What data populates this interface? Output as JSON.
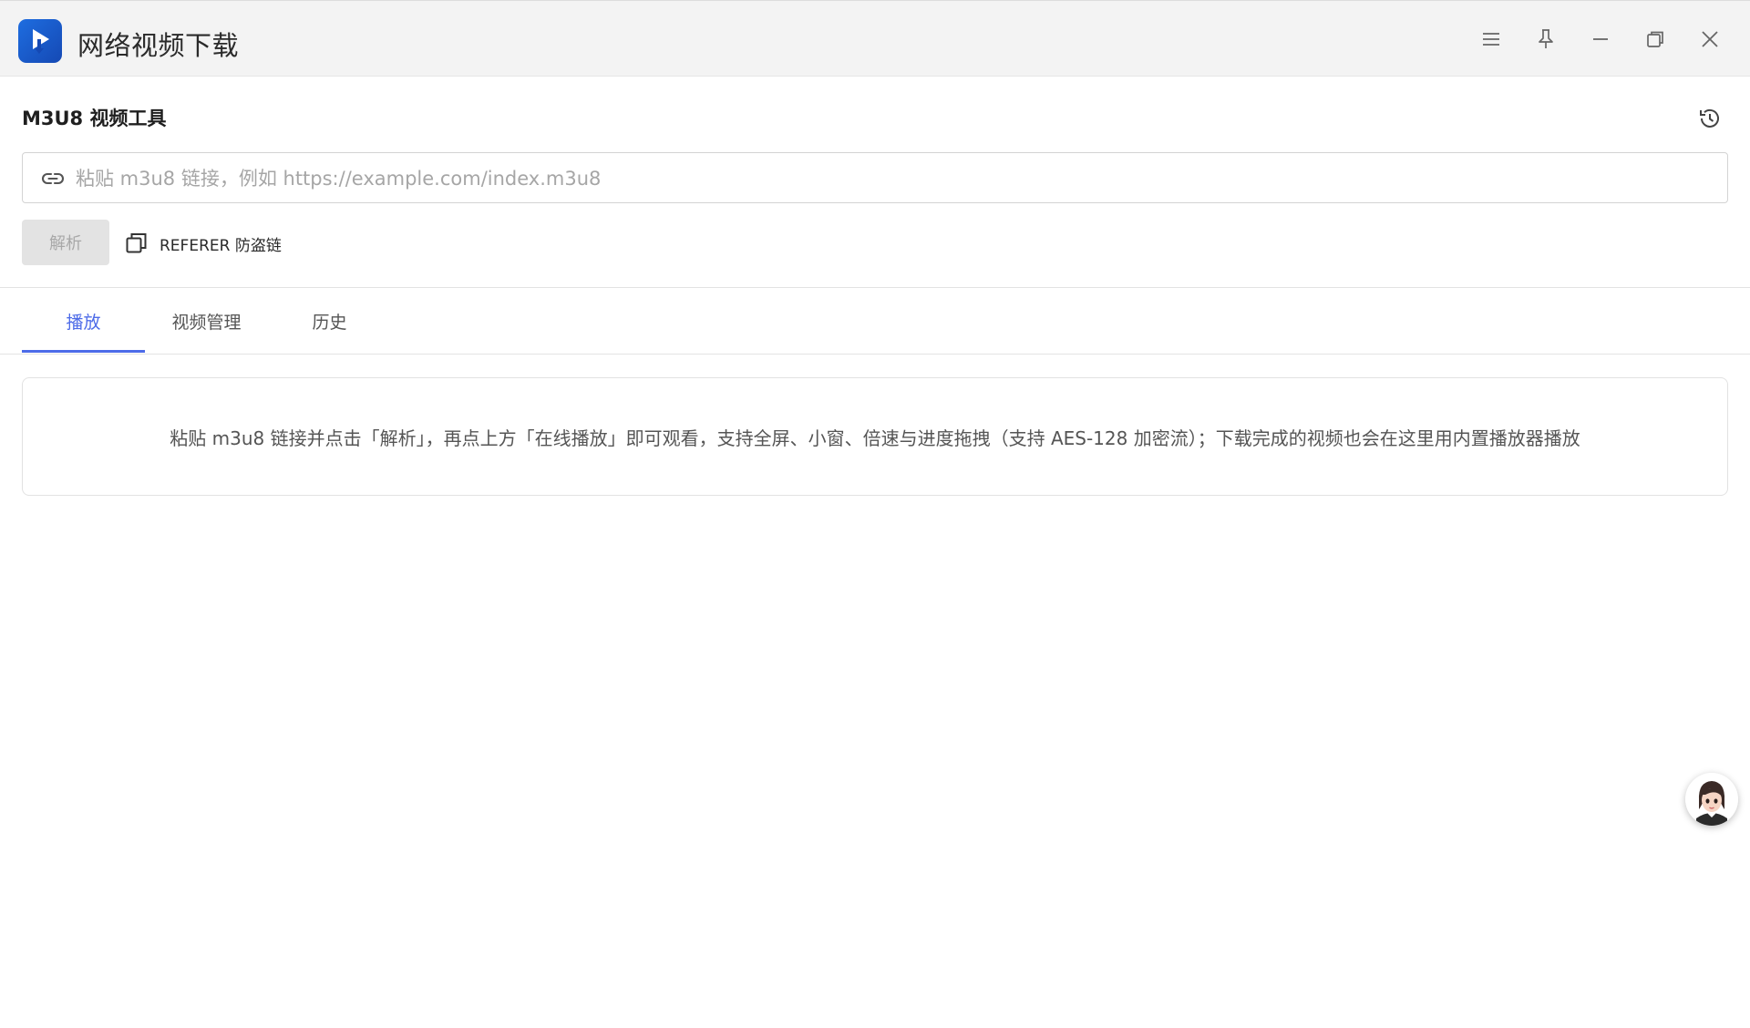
{
  "window": {
    "title": "网络视频下载",
    "controls": [
      "menu-icon",
      "pin-icon",
      "minimize-icon",
      "restore-icon",
      "close-icon"
    ]
  },
  "tool": {
    "heading": "M3U8 视频工具",
    "url_input": {
      "value": "",
      "placeholder": "粘贴 m3u8 链接，例如 https://example.com/index.m3u8"
    },
    "parse_label": "解析",
    "referer_label": "REFERER 防盗链"
  },
  "tabs": [
    {
      "label": "播放",
      "active": true
    },
    {
      "label": "视频管理",
      "active": false
    },
    {
      "label": "历史",
      "active": false
    }
  ],
  "player_hint": "粘贴 m3u8 链接并点击「解析」，再点上方「在线播放」即可观看，支持全屏、小窗、倍速与进度拖拽（支持 AES-128 加密流）；下载完成的视频也会在这里用内置播放器播放",
  "colors": {
    "accent": "#4d6be8",
    "titlebar_bg": "#f3f3f3",
    "logo": "#1e6de0",
    "disabled_button": "#e3e3e3"
  }
}
